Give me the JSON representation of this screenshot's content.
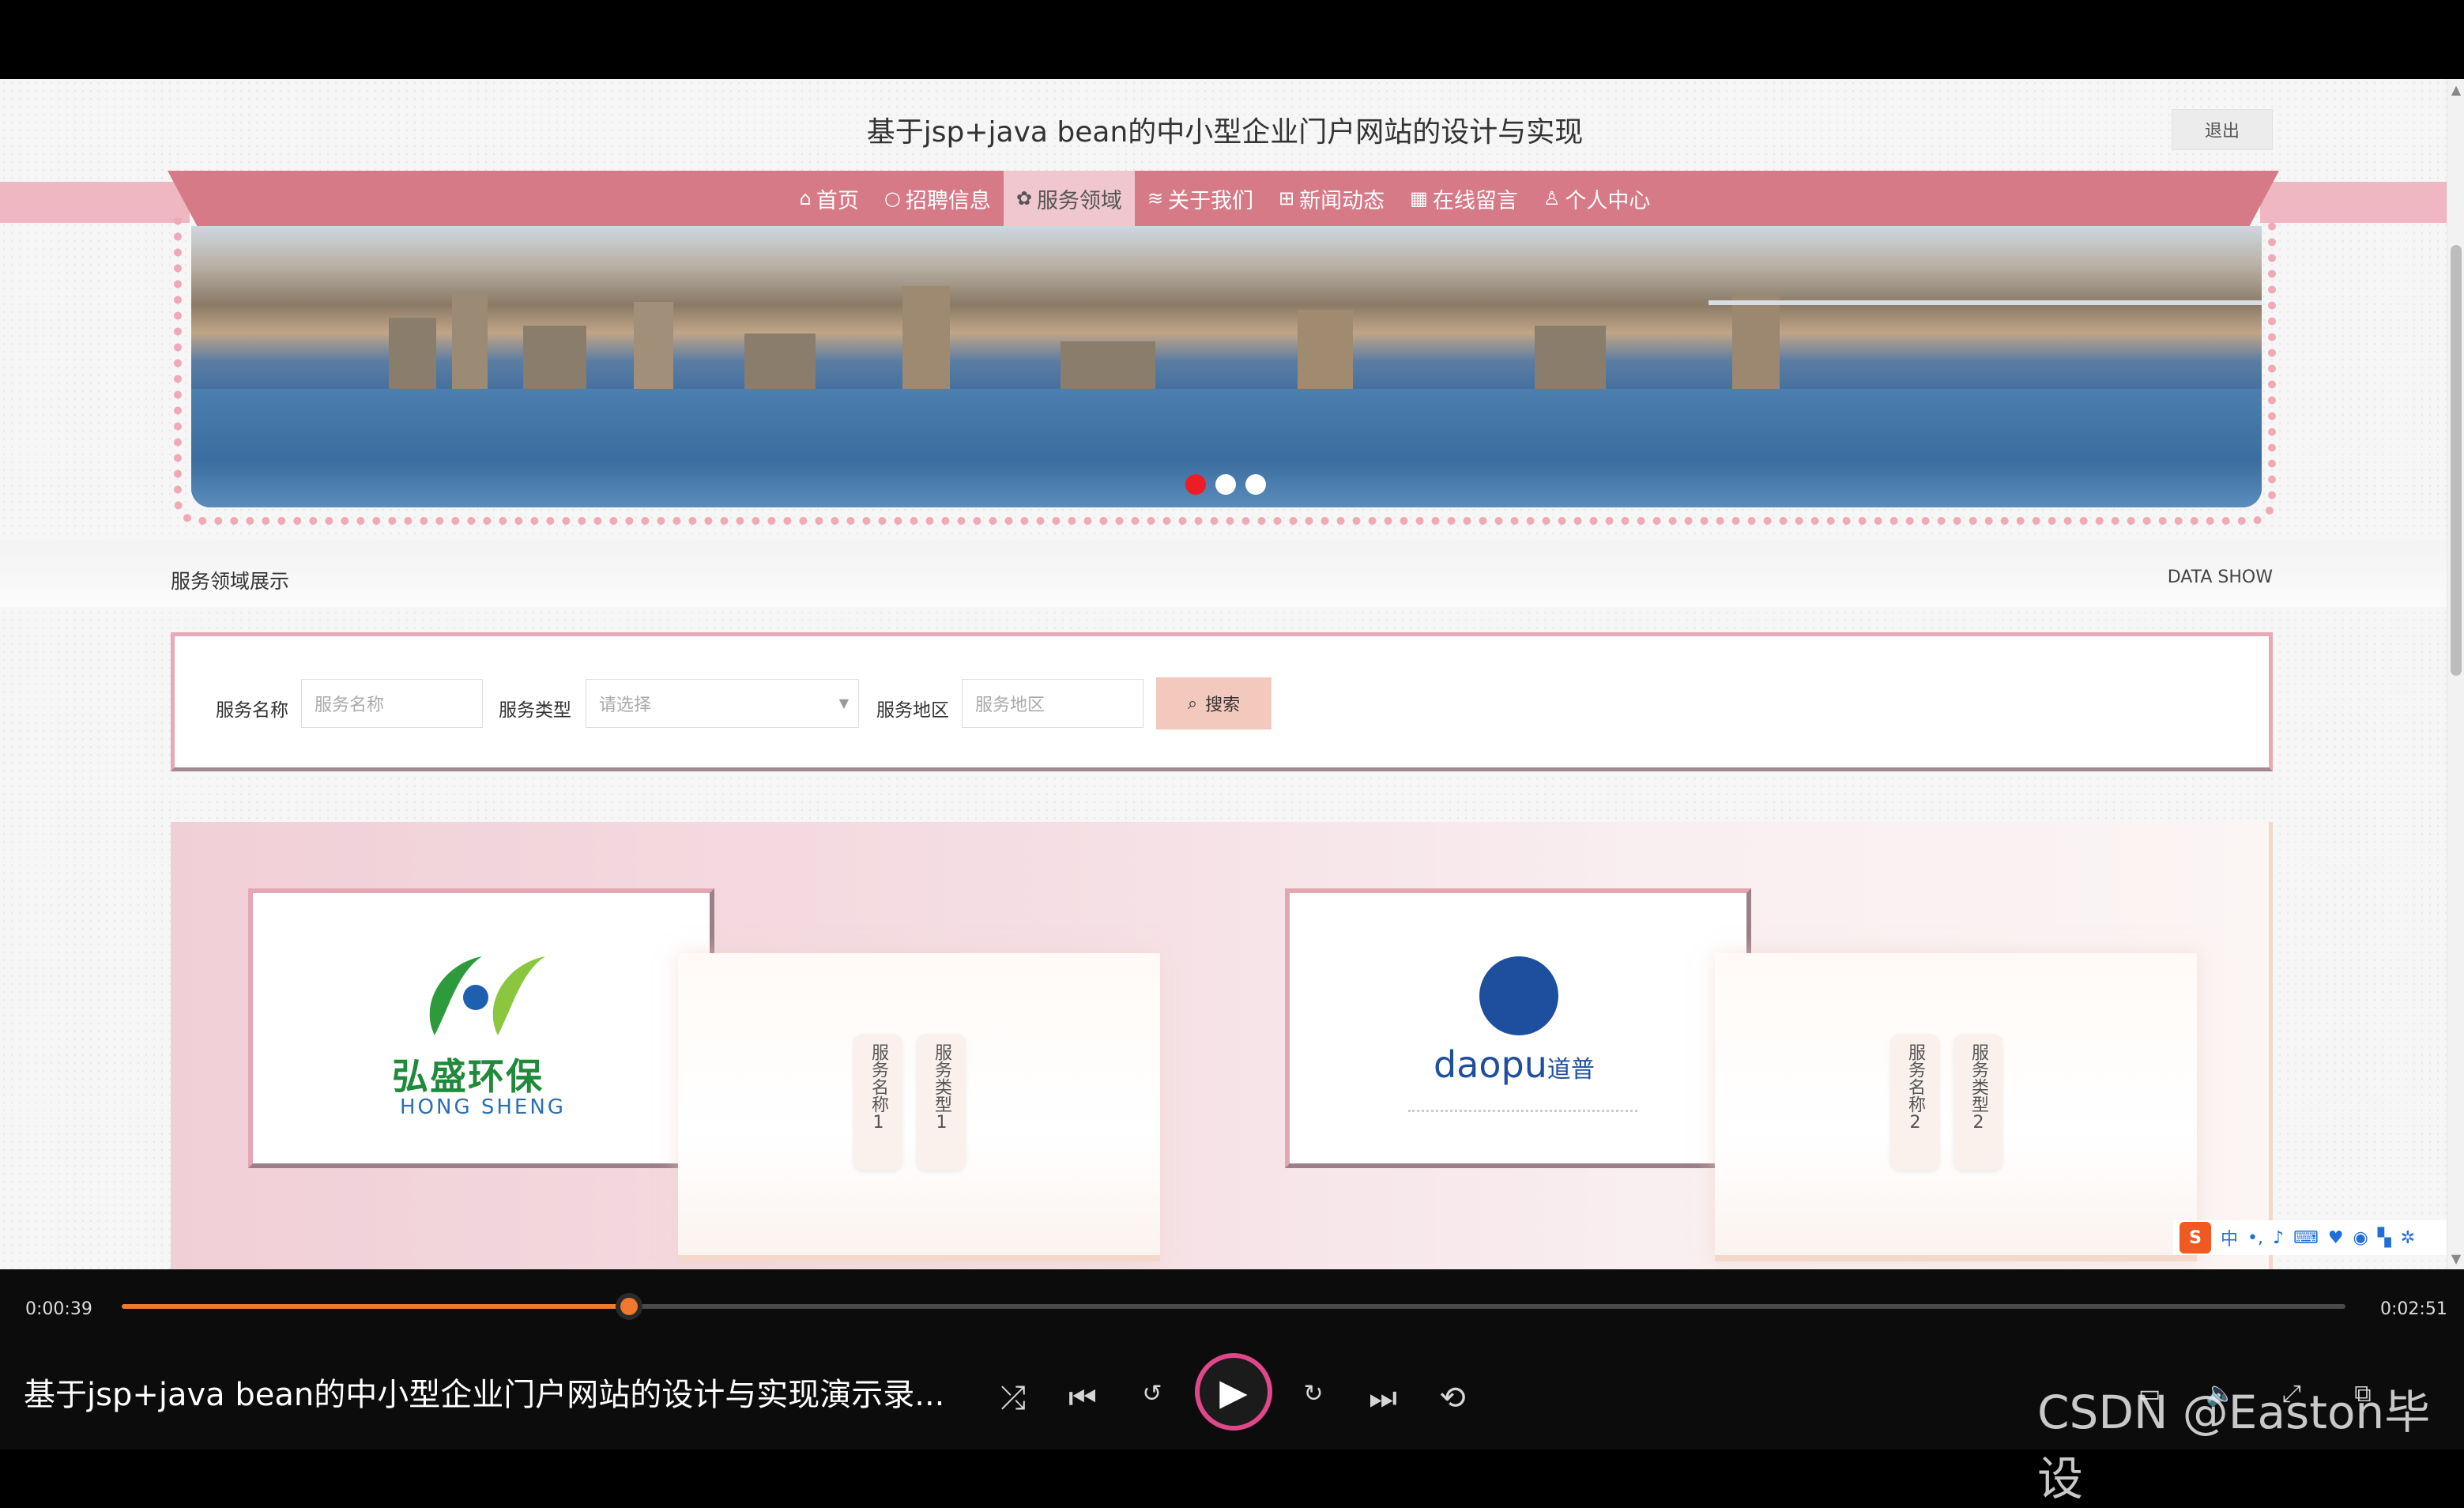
{
  "site": {
    "title": "基于jsp+java bean的中小型企业门户网站的设计与实现",
    "logout_label": "退出"
  },
  "nav": {
    "items": [
      {
        "icon": "home-icon",
        "glyph": "⌂",
        "label": "首页"
      },
      {
        "icon": "circle-icon",
        "glyph": "○",
        "label": "招聘信息"
      },
      {
        "icon": "paw-icon",
        "glyph": "✿",
        "label": "服务领域"
      },
      {
        "icon": "sliders-icon",
        "glyph": "≋",
        "label": "关于我们"
      },
      {
        "icon": "gift-icon",
        "glyph": "⊞",
        "label": "新闻动态"
      },
      {
        "icon": "calendar-icon",
        "glyph": "▦",
        "label": "在线留言"
      },
      {
        "icon": "user-icon",
        "glyph": "♙",
        "label": "个人中心"
      }
    ],
    "active_index": 2
  },
  "banner": {
    "slides": 3,
    "active_slide": 0
  },
  "section": {
    "title": "服务领域展示",
    "subtitle": "DATA SHOW"
  },
  "search": {
    "name_label": "服务名称",
    "name_placeholder": "服务名称",
    "type_label": "服务类型",
    "type_value": "请选择",
    "area_label": "服务地区",
    "area_placeholder": "服务地区",
    "button_label": "搜索"
  },
  "cards": [
    {
      "logo_cn": "弘盛环保",
      "logo_en": "HONG SHENG",
      "name_tag": "服务名称1",
      "type_tag": "服务类型1"
    },
    {
      "logo_en": "daopu",
      "logo_cn": "道普",
      "name_tag": "服务名称2",
      "type_tag": "服务类型2"
    }
  ],
  "ime": {
    "brand": "S",
    "lang": "中"
  },
  "player": {
    "current_time": "0:00:39",
    "total_time": "0:02:51",
    "progress": 0.228,
    "video_title": "基于jsp+java bean的中小型企业门户网站的设计与实现演示录...",
    "watermark": "CSDN @Easton毕设",
    "accent_color": "#f0782f"
  }
}
